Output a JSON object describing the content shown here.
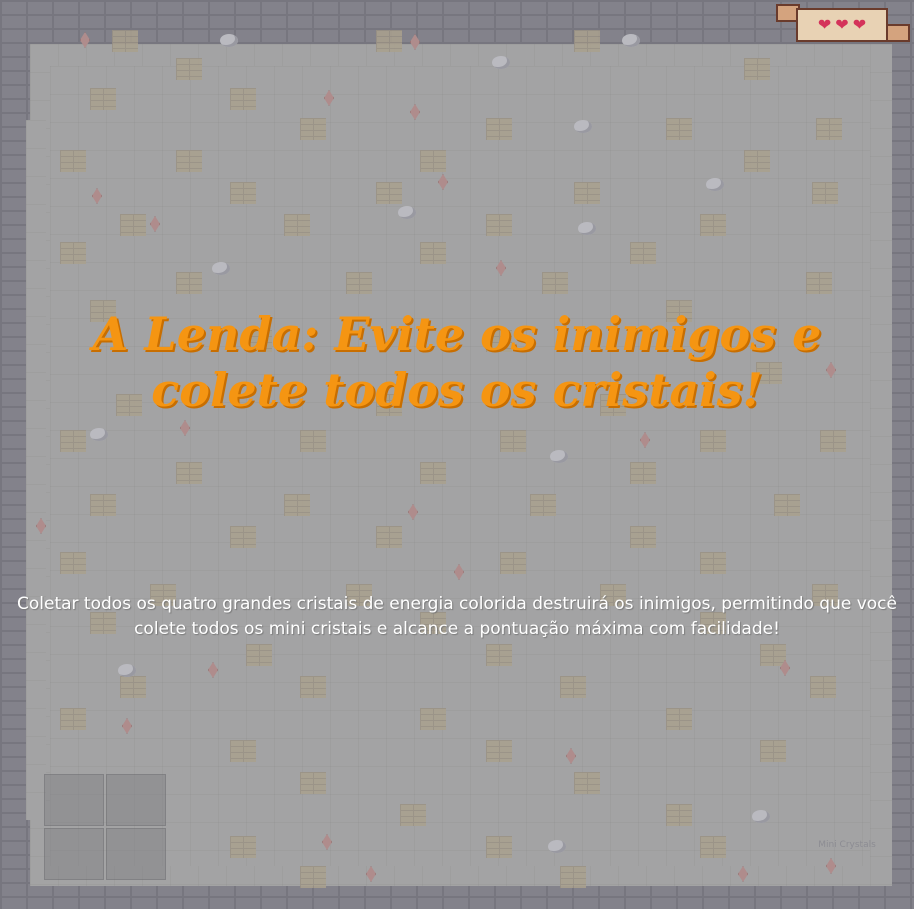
{
  "hud": {
    "hearts": [
      "heart",
      "heart",
      "heart"
    ],
    "heart_color": "#d4335a"
  },
  "overlay": {
    "title": "A Lenda: Evite os inimigos e colete todos os cristais!",
    "description": "Coletar todos os quatro grandes cristais de energia colorida destruirá os inimigos, permitindo que você colete todos os mini cristais e alcance a pontuação máxima com facilidade!",
    "title_color": "#f59512",
    "description_color": "#ffffff"
  },
  "map": {
    "floor_color": "#a7a7a8",
    "wall_color": "#7e7d88",
    "crystal_color": "#b78a8a",
    "mini_crystals_label": "Mini Crystals"
  }
}
